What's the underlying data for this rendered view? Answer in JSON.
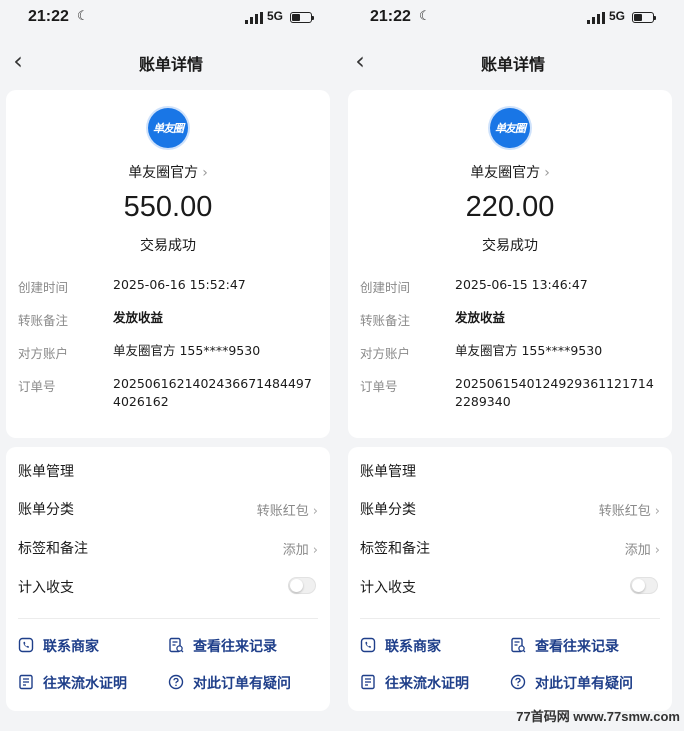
{
  "panels": [
    {
      "status_bar": {
        "time": "21:22",
        "network": "5G"
      },
      "nav": {
        "title": "账单详情"
      },
      "merchant": {
        "logo_text": "单友圈",
        "name": "单友圈官方"
      },
      "amount": "550.00",
      "status": "交易成功",
      "details": [
        {
          "label": "创建时间",
          "value": "2025-06-16 15:52:47"
        },
        {
          "label": "转账备注",
          "value": "发放收益"
        },
        {
          "label": "对方账户",
          "value": "单友圈官方 155****9530"
        },
        {
          "label": "订单号",
          "value": "2025061621402436671484497 4026162"
        }
      ],
      "management": {
        "title": "账单管理",
        "category_label": "账单分类",
        "category_value": "转账红包",
        "tags_label": "标签和备注",
        "tags_value": "添加",
        "include_label": "计入收支",
        "include_enabled": false
      },
      "actions": [
        "联系商家",
        "查看往来记录",
        "往来流水证明",
        "对此订单有疑问"
      ]
    },
    {
      "status_bar": {
        "time": "21:22",
        "network": "5G"
      },
      "nav": {
        "title": "账单详情"
      },
      "merchant": {
        "logo_text": "单友圈",
        "name": "单友圈官方"
      },
      "amount": "220.00",
      "status": "交易成功",
      "details": [
        {
          "label": "创建时间",
          "value": "2025-06-15 13:46:47"
        },
        {
          "label": "转账备注",
          "value": "发放收益"
        },
        {
          "label": "对方账户",
          "value": "单友圈官方 155****9530"
        },
        {
          "label": "订单号",
          "value": "2025061540124929361121714 2289340"
        }
      ],
      "management": {
        "title": "账单管理",
        "category_label": "账单分类",
        "category_value": "转账红包",
        "tags_label": "标签和备注",
        "tags_value": "添加",
        "include_label": "计入收支",
        "include_enabled": false
      },
      "actions": [
        "联系商家",
        "查看往来记录",
        "往来流水证明",
        "对此订单有疑问"
      ]
    }
  ],
  "watermark": "77首码网 www.77smw.com",
  "colors": {
    "accent": "#1976e6",
    "action_text": "#1f3f8a",
    "background": "#f3f4f6"
  }
}
